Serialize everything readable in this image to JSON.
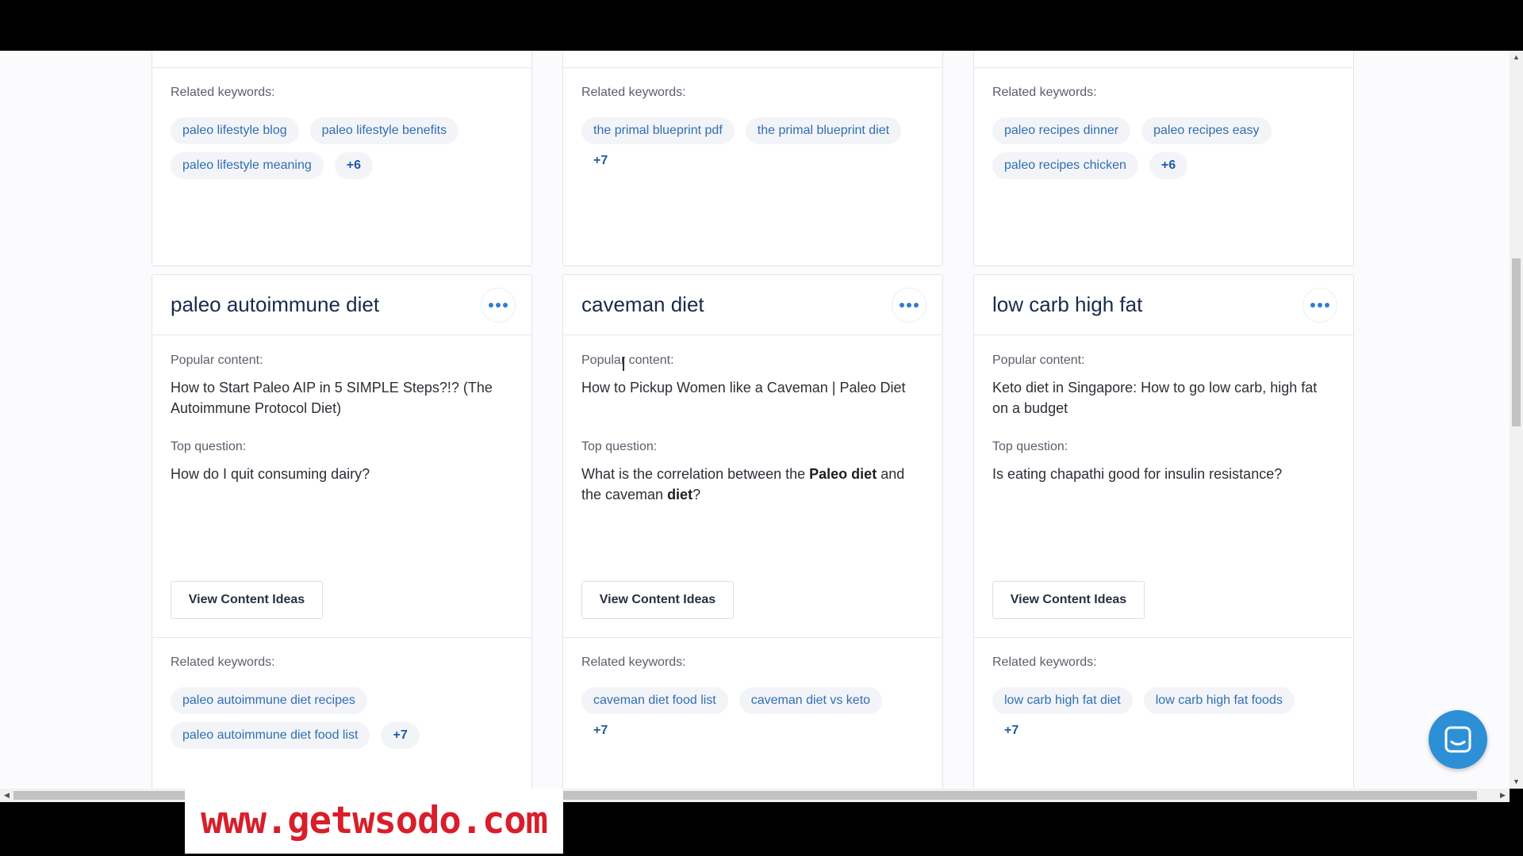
{
  "top_cards": [
    {
      "related_label": "Related keywords:",
      "keywords": [
        "paleo lifestyle blog",
        "paleo lifestyle benefits",
        "paleo lifestyle meaning"
      ],
      "more": "+6"
    },
    {
      "related_label": "Related keywords:",
      "keywords": [
        "the primal blueprint pdf",
        "the primal blueprint diet"
      ],
      "more": "+7"
    },
    {
      "related_label": "Related keywords:",
      "keywords": [
        "paleo recipes dinner",
        "paleo recipes easy",
        "paleo recipes chicken"
      ],
      "more": "+6"
    }
  ],
  "cards": [
    {
      "title": "paleo autoimmune diet",
      "popular_label": "Popular content:",
      "popular": "How to Start Paleo AIP in 5 SIMPLE Steps?!? (The Autoimmune Protocol Diet)",
      "question_label": "Top question:",
      "question_parts": [
        "How do I quit consuming dairy?"
      ],
      "button": "View Content Ideas",
      "related_label": "Related keywords:",
      "keywords": [
        "paleo autoimmune diet recipes",
        "paleo autoimmune diet food list"
      ],
      "more": "+7"
    },
    {
      "title": "caveman diet",
      "popular_label": "Popular content:",
      "popular": "How to Pickup Women like a Caveman | Paleo Diet",
      "question_label": "Top question:",
      "question_parts": [
        "What is the correlation between the ",
        "Paleo diet",
        " and the caveman ",
        "diet",
        "?"
      ],
      "button": "View Content Ideas",
      "related_label": "Related keywords:",
      "keywords": [
        "caveman diet food list",
        "caveman diet vs keto"
      ],
      "more": "+7"
    },
    {
      "title": "low carb high fat",
      "popular_label": "Popular content:",
      "popular": "Keto diet in Singapore: How to go low carb, high fat on a budget",
      "question_label": "Top question:",
      "question_parts": [
        "Is eating chapathi good for insulin resistance?"
      ],
      "button": "View Content Ideas",
      "related_label": "Related keywords:",
      "keywords": [
        "low carb high fat diet",
        "low carb high fat foods"
      ],
      "more": "+7"
    }
  ],
  "watermark": "www.getwsodo.com",
  "colors": {
    "accent": "#2e7dd1",
    "chip_text": "#2f6fb4",
    "chat_button": "#2d90d6",
    "watermark": "#d81e2a"
  },
  "icons": {
    "more": "more-dots-icon",
    "chat": "chat-icon"
  }
}
